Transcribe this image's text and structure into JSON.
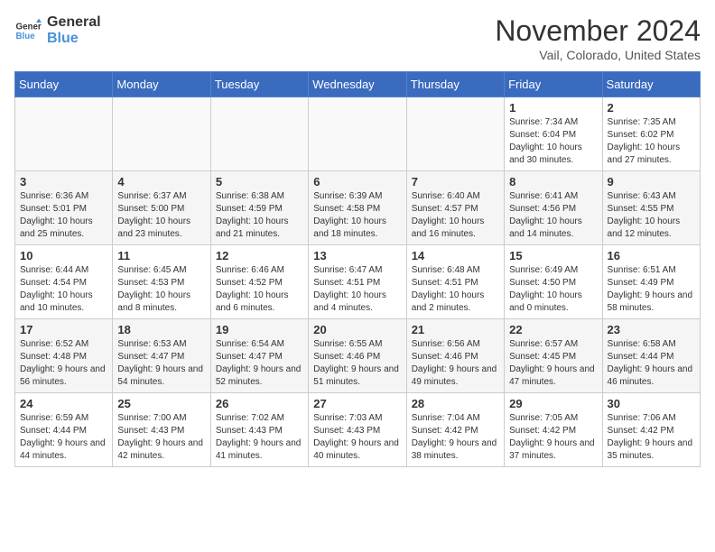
{
  "header": {
    "logo_line1": "General",
    "logo_line2": "Blue",
    "month": "November 2024",
    "location": "Vail, Colorado, United States"
  },
  "weekdays": [
    "Sunday",
    "Monday",
    "Tuesday",
    "Wednesday",
    "Thursday",
    "Friday",
    "Saturday"
  ],
  "weeks": [
    [
      {
        "day": "",
        "info": ""
      },
      {
        "day": "",
        "info": ""
      },
      {
        "day": "",
        "info": ""
      },
      {
        "day": "",
        "info": ""
      },
      {
        "day": "",
        "info": ""
      },
      {
        "day": "1",
        "info": "Sunrise: 7:34 AM\nSunset: 6:04 PM\nDaylight: 10 hours and 30 minutes."
      },
      {
        "day": "2",
        "info": "Sunrise: 7:35 AM\nSunset: 6:02 PM\nDaylight: 10 hours and 27 minutes."
      }
    ],
    [
      {
        "day": "3",
        "info": "Sunrise: 6:36 AM\nSunset: 5:01 PM\nDaylight: 10 hours and 25 minutes."
      },
      {
        "day": "4",
        "info": "Sunrise: 6:37 AM\nSunset: 5:00 PM\nDaylight: 10 hours and 23 minutes."
      },
      {
        "day": "5",
        "info": "Sunrise: 6:38 AM\nSunset: 4:59 PM\nDaylight: 10 hours and 21 minutes."
      },
      {
        "day": "6",
        "info": "Sunrise: 6:39 AM\nSunset: 4:58 PM\nDaylight: 10 hours and 18 minutes."
      },
      {
        "day": "7",
        "info": "Sunrise: 6:40 AM\nSunset: 4:57 PM\nDaylight: 10 hours and 16 minutes."
      },
      {
        "day": "8",
        "info": "Sunrise: 6:41 AM\nSunset: 4:56 PM\nDaylight: 10 hours and 14 minutes."
      },
      {
        "day": "9",
        "info": "Sunrise: 6:43 AM\nSunset: 4:55 PM\nDaylight: 10 hours and 12 minutes."
      }
    ],
    [
      {
        "day": "10",
        "info": "Sunrise: 6:44 AM\nSunset: 4:54 PM\nDaylight: 10 hours and 10 minutes."
      },
      {
        "day": "11",
        "info": "Sunrise: 6:45 AM\nSunset: 4:53 PM\nDaylight: 10 hours and 8 minutes."
      },
      {
        "day": "12",
        "info": "Sunrise: 6:46 AM\nSunset: 4:52 PM\nDaylight: 10 hours and 6 minutes."
      },
      {
        "day": "13",
        "info": "Sunrise: 6:47 AM\nSunset: 4:51 PM\nDaylight: 10 hours and 4 minutes."
      },
      {
        "day": "14",
        "info": "Sunrise: 6:48 AM\nSunset: 4:51 PM\nDaylight: 10 hours and 2 minutes."
      },
      {
        "day": "15",
        "info": "Sunrise: 6:49 AM\nSunset: 4:50 PM\nDaylight: 10 hours and 0 minutes."
      },
      {
        "day": "16",
        "info": "Sunrise: 6:51 AM\nSunset: 4:49 PM\nDaylight: 9 hours and 58 minutes."
      }
    ],
    [
      {
        "day": "17",
        "info": "Sunrise: 6:52 AM\nSunset: 4:48 PM\nDaylight: 9 hours and 56 minutes."
      },
      {
        "day": "18",
        "info": "Sunrise: 6:53 AM\nSunset: 4:47 PM\nDaylight: 9 hours and 54 minutes."
      },
      {
        "day": "19",
        "info": "Sunrise: 6:54 AM\nSunset: 4:47 PM\nDaylight: 9 hours and 52 minutes."
      },
      {
        "day": "20",
        "info": "Sunrise: 6:55 AM\nSunset: 4:46 PM\nDaylight: 9 hours and 51 minutes."
      },
      {
        "day": "21",
        "info": "Sunrise: 6:56 AM\nSunset: 4:46 PM\nDaylight: 9 hours and 49 minutes."
      },
      {
        "day": "22",
        "info": "Sunrise: 6:57 AM\nSunset: 4:45 PM\nDaylight: 9 hours and 47 minutes."
      },
      {
        "day": "23",
        "info": "Sunrise: 6:58 AM\nSunset: 4:44 PM\nDaylight: 9 hours and 46 minutes."
      }
    ],
    [
      {
        "day": "24",
        "info": "Sunrise: 6:59 AM\nSunset: 4:44 PM\nDaylight: 9 hours and 44 minutes."
      },
      {
        "day": "25",
        "info": "Sunrise: 7:00 AM\nSunset: 4:43 PM\nDaylight: 9 hours and 42 minutes."
      },
      {
        "day": "26",
        "info": "Sunrise: 7:02 AM\nSunset: 4:43 PM\nDaylight: 9 hours and 41 minutes."
      },
      {
        "day": "27",
        "info": "Sunrise: 7:03 AM\nSunset: 4:43 PM\nDaylight: 9 hours and 40 minutes."
      },
      {
        "day": "28",
        "info": "Sunrise: 7:04 AM\nSunset: 4:42 PM\nDaylight: 9 hours and 38 minutes."
      },
      {
        "day": "29",
        "info": "Sunrise: 7:05 AM\nSunset: 4:42 PM\nDaylight: 9 hours and 37 minutes."
      },
      {
        "day": "30",
        "info": "Sunrise: 7:06 AM\nSunset: 4:42 PM\nDaylight: 9 hours and 35 minutes."
      }
    ]
  ]
}
